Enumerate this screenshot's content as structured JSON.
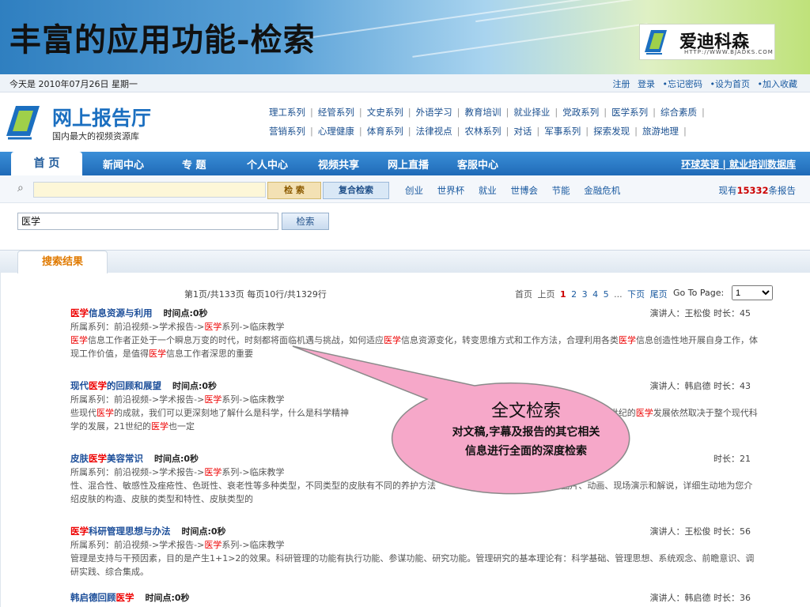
{
  "slide": {
    "title": "丰富的应用功能-检索",
    "logo": {
      "brand": "爱迪科森",
      "url": "HTTP://WWW.BJADKS.COM"
    }
  },
  "site": {
    "topbar": {
      "date": "今天是 2010年07月26日 星期一",
      "links": [
        "注册",
        "登录",
        "•忘记密码",
        "•设为首页",
        "•加入收藏"
      ]
    },
    "brand": {
      "name": "网上报告厅",
      "tagline": "国内最大的视频资源库"
    },
    "categories_row1": [
      "理工系列",
      "经管系列",
      "文史系列",
      "外语学习",
      "教育培训",
      "就业择业",
      "党政系列",
      "医学系列",
      "综合素质"
    ],
    "categories_row2": [
      "营销系列",
      "心理健康",
      "体育系列",
      "法律视点",
      "农林系列",
      "对话",
      "军事系列",
      "探索发现",
      "旅游地理"
    ],
    "nav": {
      "home": "首 页",
      "items": [
        "新闻中心",
        "专 题",
        "个人中心",
        "视频共享",
        "网上直播",
        "客服中心"
      ],
      "right": "环球英语 | 就业培训数据库"
    },
    "search": {
      "button": "检 索",
      "advanced": "复合检索",
      "hot": [
        "创业",
        "世界杯",
        "就业",
        "世博会",
        "节能",
        "金融危机"
      ],
      "count_prefix": "现有",
      "count": "15332",
      "count_suffix": "条报告"
    },
    "query": {
      "value": "医学",
      "button": "检索"
    },
    "tab": "搜索结果",
    "pager": {
      "info": "第1页/共133页  每页10行/共1329行",
      "first": "首页",
      "prev": "上页",
      "pages": [
        "1",
        "2",
        "3",
        "4",
        "5"
      ],
      "ellipsis": "...",
      "next": "下页",
      "last": "尾页",
      "goto": "Go To Page:",
      "selected": "1"
    },
    "results": [
      {
        "title_pre": "",
        "title_hl": "医学",
        "title_post": "信息资源与利用",
        "time": "时间点:0秒",
        "meta": "演讲人：王松俊  时长：45",
        "path_pre": "所属系列：前沿视频->学术报告->",
        "path_hl": "医学",
        "path_post": "系列->临床教学",
        "desc": [
          {
            "t": "医学",
            "hl": true
          },
          {
            "t": "信息工作者正处于一个瞬息万变的时代，时刻都将面临机遇与挑战，如何适应"
          },
          {
            "t": "医学",
            "hl": true
          },
          {
            "t": "信息资源变化，转变思维方式和工作方法，合理利用各类"
          },
          {
            "t": "医学",
            "hl": true
          },
          {
            "t": "信息创造性地开展自身工作，体现工作价值，是值得"
          },
          {
            "t": "医学",
            "hl": true
          },
          {
            "t": "信息工作者深思的重要"
          }
        ]
      },
      {
        "title_pre": "现代",
        "title_hl": "医学",
        "title_post": "的回顾和展望",
        "time": "时间点:0秒",
        "meta": "演讲人：韩启德  时长：43",
        "path_pre": "所属系列：前沿视频->学术报告->",
        "path_hl": "医学",
        "path_post": "系列->临床教学",
        "desc": [
          {
            "t": "些现代"
          },
          {
            "t": "医学",
            "hl": true
          },
          {
            "t": "的成就，我们可以更深刻地了解什么是科学，什么是科学精神"
          },
          {
            "t": "                                                                                    了解21世纪的"
          },
          {
            "t": "医学",
            "hl": true
          },
          {
            "t": "发展依然取决于整个现代科学的发展，21世纪的"
          },
          {
            "t": "医学",
            "hl": true
          },
          {
            "t": "也一定"
          }
        ]
      },
      {
        "title_pre": "皮肤",
        "title_hl": "医学",
        "title_post": "美容常识",
        "time": "时间点:0秒",
        "meta": "时长：21",
        "path_pre": "所属系列：前沿视频->学术报告->",
        "path_hl": "医学",
        "path_post": "系列->临床教学",
        "desc": [
          {
            "t": "性、混合性、敏感性及痤疮性、色斑性、衰老性等多种类型，不同类型的皮肤有不同的养护方法"
          },
          {
            "t": "                                       通过图片、动画、现场演示和解说，详细生动地为您介绍皮肤的构造、皮肤的类型和特性、皮肤类型的"
          }
        ]
      },
      {
        "title_pre": "",
        "title_hl": "医学",
        "title_post": "科研管理思想与办法",
        "time": "时间点:0秒",
        "meta": "演讲人：王松俊  时长：56",
        "path_pre": "所属系列：前沿视频->学术报告->",
        "path_hl": "医学",
        "path_post": "系列->临床教学",
        "desc": [
          {
            "t": "管理是支持与干预因素，目的是产生1+1>2的效果。科研管理的功能有执行功能、参谋功能、研究功能。管理研究的基本理论有：科学基础、管理思想、系统观念、前瞻意识、调研实践、综合集成。"
          }
        ]
      },
      {
        "title_pre": "韩启德回顾",
        "title_hl": "医学",
        "title_post": "",
        "time": "时间点:0秒",
        "meta": "演讲人：韩启德  时长：36",
        "path_pre": "",
        "path_hl": "",
        "path_post": "",
        "desc": []
      }
    ]
  },
  "callout": {
    "title": "全文检索",
    "line1": "对文稿,字幕及报告的其它相关",
    "line2": "信息进行全面的深度检索",
    "fill": "#f6a8c9",
    "stroke": "#8a8a8a"
  },
  "colors": {
    "accent": "#1f6ab7",
    "highlight": "#e00000",
    "tab": "#e07a00"
  }
}
